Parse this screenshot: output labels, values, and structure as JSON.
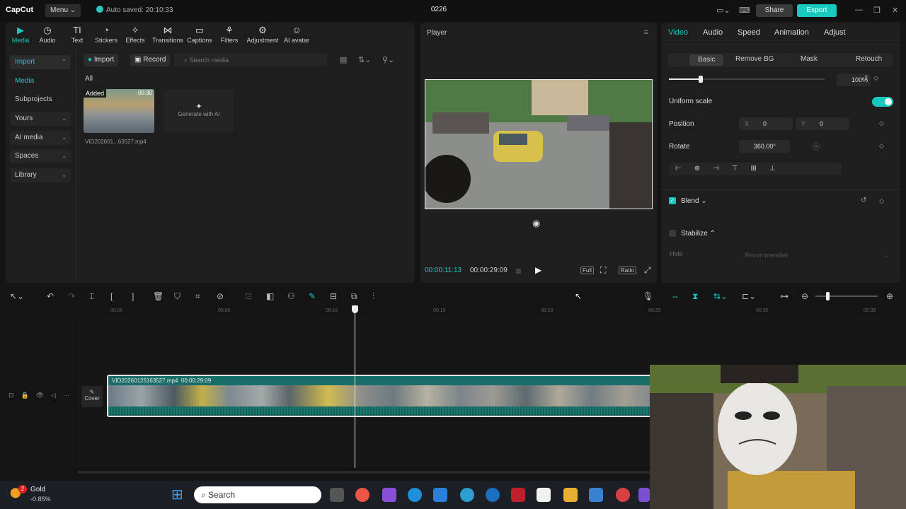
{
  "app": {
    "logo": "CapCut",
    "menu": "Menu",
    "saved": "Auto saved: 20:10:33",
    "project": "0226",
    "share": "Share",
    "export": "Export"
  },
  "toolbar": [
    {
      "label": "Media",
      "icon": "▶"
    },
    {
      "label": "Audio",
      "icon": "◷"
    },
    {
      "label": "Text",
      "icon": "TI"
    },
    {
      "label": "Stickers",
      "icon": "◔"
    },
    {
      "label": "Effects",
      "icon": "✧"
    },
    {
      "label": "Transitions",
      "icon": "⋈"
    },
    {
      "label": "Captions",
      "icon": "▭"
    },
    {
      "label": "Filters",
      "icon": "⚘"
    },
    {
      "label": "Adjustment",
      "icon": "⚙"
    },
    {
      "label": "AI avatar",
      "icon": "☺"
    }
  ],
  "sidebar": {
    "import": "Import",
    "media": "Media",
    "subprojects": "Subprojects",
    "yours": "Yours",
    "ai_media": "AI media",
    "spaces": "Spaces",
    "library": "Library"
  },
  "media": {
    "import_btn": "Import",
    "record_btn": "Record",
    "search_placeholder": "Search media",
    "all": "All",
    "added": "Added",
    "duration": "00:30",
    "filename": "VID202601...63527.mp4",
    "generate": "Generate with AI"
  },
  "player": {
    "title": "Player",
    "current": "00:00:11:13",
    "total": "00:00:29:09",
    "full": "Full",
    "ratio": "Ratio"
  },
  "props": {
    "tabs": [
      "Video",
      "Audio",
      "Speed",
      "Animation",
      "Adjust"
    ],
    "subtabs": [
      "Basic",
      "Remove BG",
      "Mask",
      "Retouch"
    ],
    "scale_value": "100%",
    "uniform_scale": "Uniform scale",
    "position": "Position",
    "pos_x_label": "X",
    "pos_x": "0",
    "pos_y_label": "Y",
    "pos_y": "0",
    "rotate": "Rotate",
    "rotate_value": "360.00°",
    "blend": "Blend",
    "stabilize": "Stabilize",
    "hide": "Hide",
    "recommended": "Recommended"
  },
  "timeline": {
    "ticks": [
      "00:00",
      "00:05",
      "00:10",
      "00:15",
      "00:20",
      "00:25",
      "00:30",
      "00:35"
    ],
    "cover": "Cover",
    "clip_name": "VID20260125163527.mp4",
    "clip_duration": "00:00:29:09"
  },
  "taskbar": {
    "gold": "Gold",
    "gold_change": "-0.85%",
    "badge": "2",
    "search": "Search"
  },
  "colors": {
    "accent": "#18c9c0",
    "bg": "#141414",
    "panel": "#1e1e1e"
  }
}
